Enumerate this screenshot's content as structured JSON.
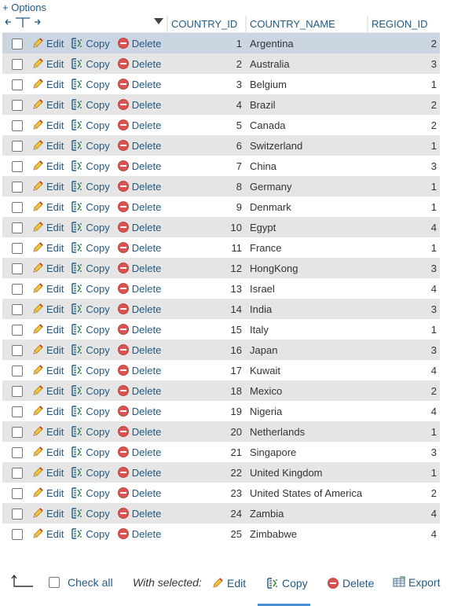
{
  "options_link": "+ Options",
  "table": {
    "columns": [
      "COUNTRY_ID",
      "COUNTRY_NAME",
      "REGION_ID"
    ],
    "actions": {
      "edit": "Edit",
      "copy": "Copy",
      "delete": "Delete"
    },
    "rows": [
      {
        "id": "1",
        "name": "Argentina",
        "region": "2"
      },
      {
        "id": "2",
        "name": "Australia",
        "region": "3"
      },
      {
        "id": "3",
        "name": "Belgium",
        "region": "1"
      },
      {
        "id": "4",
        "name": "Brazil",
        "region": "2"
      },
      {
        "id": "5",
        "name": "Canada",
        "region": "2"
      },
      {
        "id": "6",
        "name": "Switzerland",
        "region": "1"
      },
      {
        "id": "7",
        "name": "China",
        "region": "3"
      },
      {
        "id": "8",
        "name": "Germany",
        "region": "1"
      },
      {
        "id": "9",
        "name": "Denmark",
        "region": "1"
      },
      {
        "id": "10",
        "name": "Egypt",
        "region": "4"
      },
      {
        "id": "11",
        "name": "France",
        "region": "1"
      },
      {
        "id": "12",
        "name": "HongKong",
        "region": "3"
      },
      {
        "id": "13",
        "name": "Israel",
        "region": "4"
      },
      {
        "id": "14",
        "name": "India",
        "region": "3"
      },
      {
        "id": "15",
        "name": "Italy",
        "region": "1"
      },
      {
        "id": "16",
        "name": "Japan",
        "region": "3"
      },
      {
        "id": "17",
        "name": "Kuwait",
        "region": "4"
      },
      {
        "id": "18",
        "name": "Mexico",
        "region": "2"
      },
      {
        "id": "19",
        "name": "Nigeria",
        "region": "4"
      },
      {
        "id": "20",
        "name": "Netherlands",
        "region": "1"
      },
      {
        "id": "21",
        "name": "Singapore",
        "region": "3"
      },
      {
        "id": "22",
        "name": "United Kingdom",
        "region": "1"
      },
      {
        "id": "23",
        "name": "United States of America",
        "region": "2"
      },
      {
        "id": "24",
        "name": "Zambia",
        "region": "4"
      },
      {
        "id": "25",
        "name": "Zimbabwe",
        "region": "4"
      }
    ]
  },
  "footer": {
    "check_all": "Check all",
    "with_selected": "With selected:",
    "edit": "Edit",
    "copy": "Copy",
    "delete": "Delete",
    "export": "Export"
  },
  "colors": {
    "link": "#235a81",
    "row_even": "#e5e5e5",
    "row_hover": "#ccd6e2",
    "delete_icon": "#d9534f",
    "active_underline": "#4a8fd4"
  },
  "icons": {
    "edit": "pencil-icon",
    "copy": "copy-icon",
    "delete": "delete-icon",
    "export": "export-icon",
    "expand": "column-expand-arrows-icon",
    "sort": "sort-dropdown-icon",
    "select_up": "arrow-up-left-icon"
  }
}
